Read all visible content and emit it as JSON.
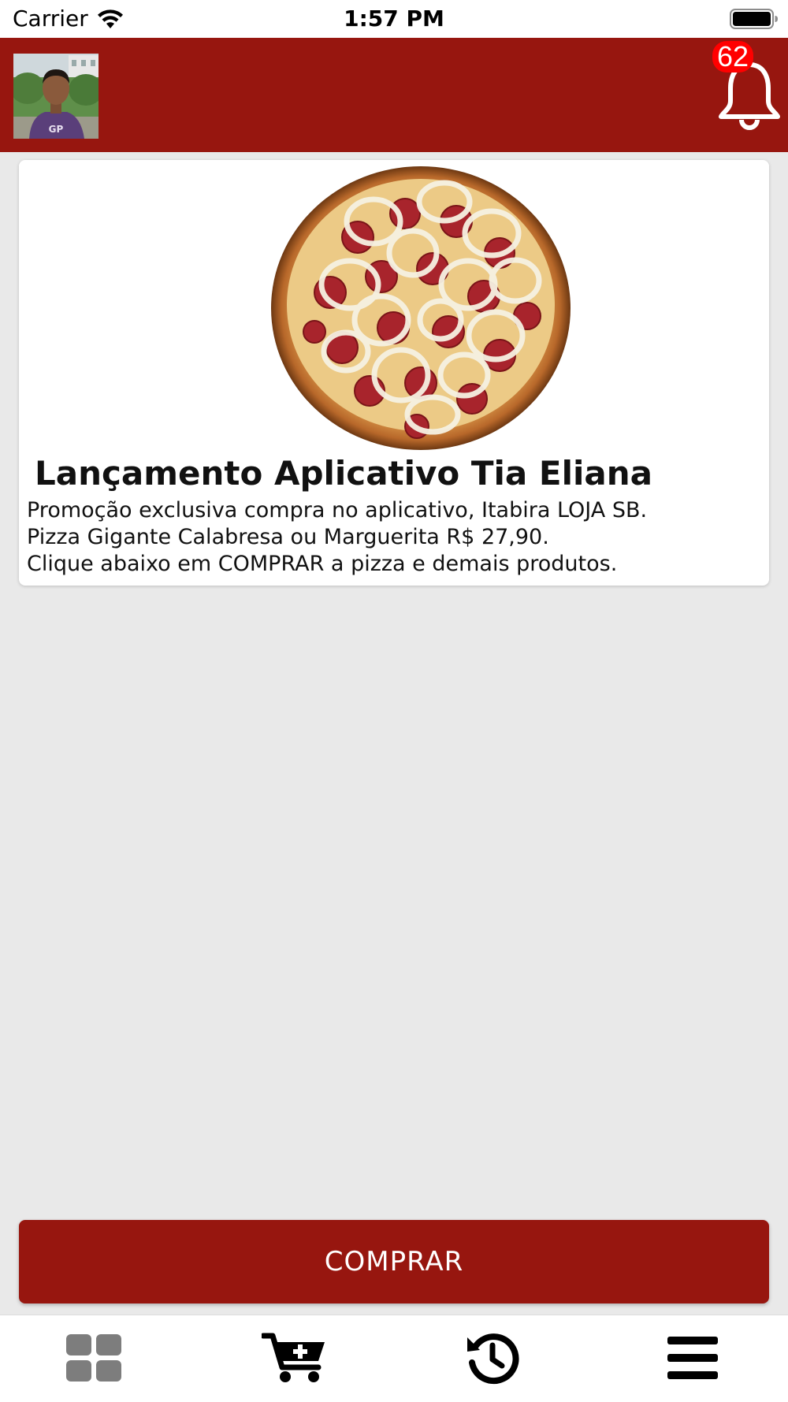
{
  "status_bar": {
    "carrier": "Carrier",
    "time": "1:57 PM",
    "wifi_icon": "wifi-icon",
    "battery_icon": "battery-full-icon"
  },
  "header": {
    "background_color": "#97160f",
    "avatar": "user-avatar-photo",
    "notification_icon": "bell-icon",
    "notification_count": "62",
    "badge_color": "#ff0000"
  },
  "news_card": {
    "image": "pizza-calabresa-photo",
    "title": "Lançamento Aplicativo Tia Eliana",
    "body_lines": [
      "Promoção exclusiva compra no aplicativo, Itabira LOJA SB.",
      "Pizza Gigante Calabresa ou Marguerita R$ 27,90.",
      "Clique abaixo em COMPRAR a pizza e demais produtos."
    ]
  },
  "buy_button": {
    "label": "COMPRAR",
    "color": "#97160f"
  },
  "tab_bar": {
    "tabs": [
      {
        "icon": "grid-icon",
        "active": true,
        "color": "#7d7d7d"
      },
      {
        "icon": "cart-add-icon",
        "active": false,
        "color": "#000000"
      },
      {
        "icon": "history-icon",
        "active": false,
        "color": "#000000"
      },
      {
        "icon": "menu-icon",
        "active": false,
        "color": "#000000"
      }
    ]
  }
}
